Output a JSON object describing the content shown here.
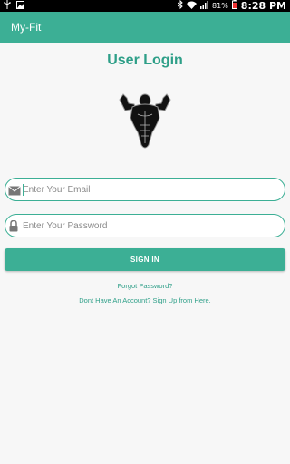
{
  "status_bar": {
    "battery_percent": "81%",
    "time": "8:28 PM",
    "icons": [
      "usb-icon",
      "image-icon",
      "bluetooth-icon",
      "wifi-icon",
      "signal-icon",
      "battery-icon"
    ]
  },
  "app_bar": {
    "title": "My-Fit",
    "color": "#3caf95"
  },
  "page": {
    "title": "User Login",
    "logo": "bodybuilder-logo"
  },
  "form": {
    "email": {
      "value": "",
      "placeholder": "Enter Your Email",
      "icon": "email-icon"
    },
    "password": {
      "value": "",
      "placeholder": "Enter Your Password",
      "icon": "lock-icon"
    },
    "signin_label": "SIGN IN"
  },
  "links": {
    "forgot_password": "Forgot Password?",
    "signup": "Dont Have An Account? Sign Up from Here."
  },
  "colors": {
    "accent": "#3caf95",
    "accent_text": "#2e9f88"
  }
}
